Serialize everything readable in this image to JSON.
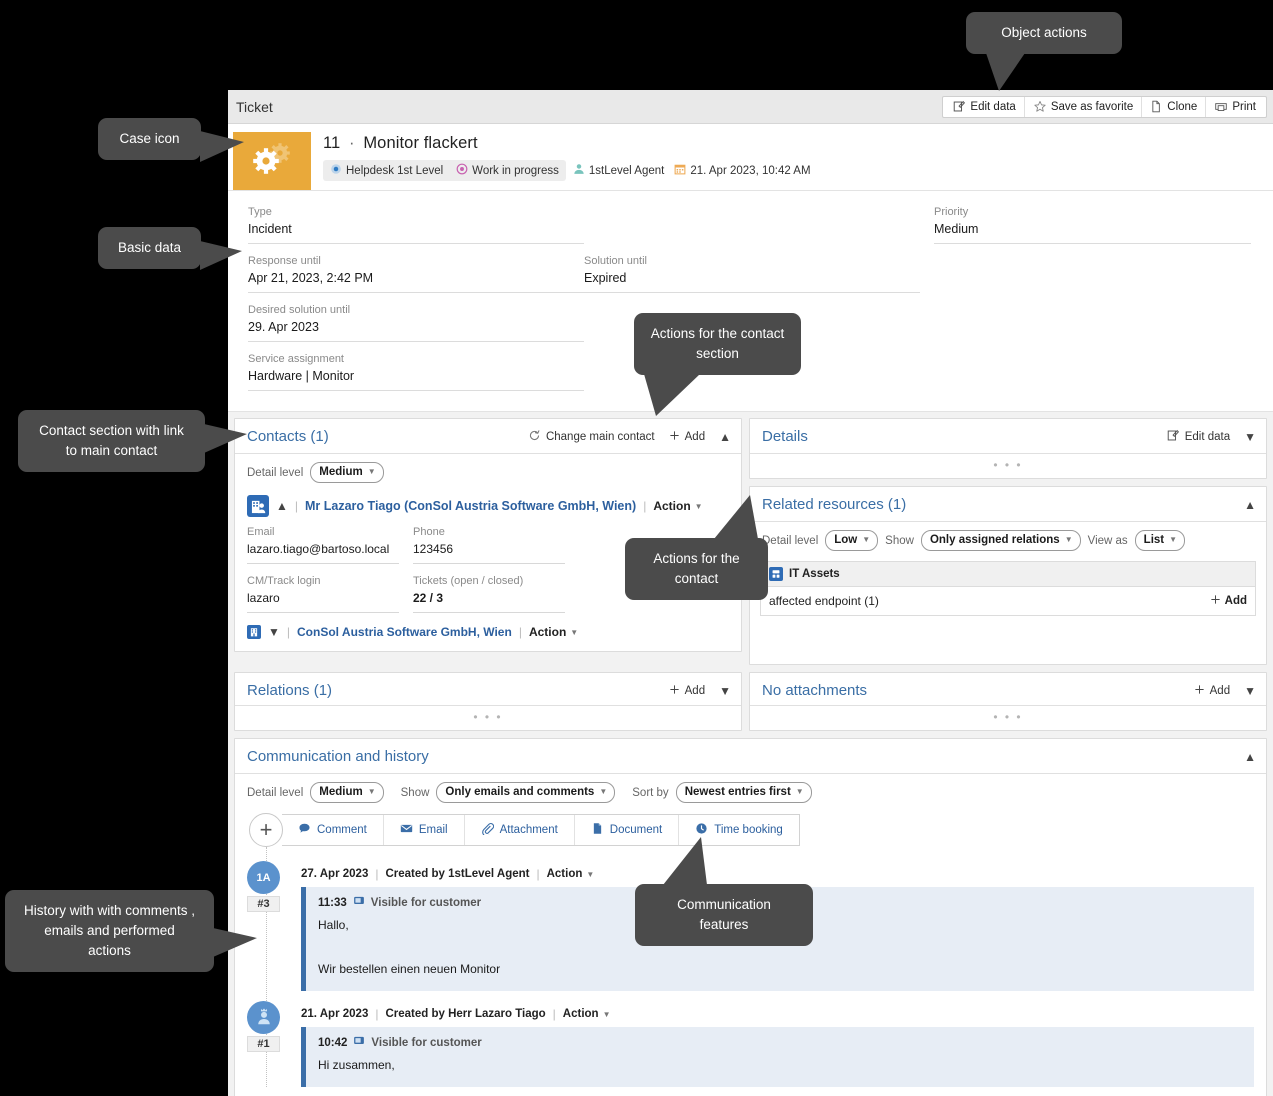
{
  "window": {
    "title": "Ticket"
  },
  "object_actions": [
    {
      "label": "Edit data",
      "icon": "edit-icon"
    },
    {
      "label": "Save as favorite",
      "icon": "star-icon"
    },
    {
      "label": "Clone",
      "icon": "copy-icon"
    },
    {
      "label": "Print",
      "icon": "printer-icon"
    }
  ],
  "case_header": {
    "icon": "gears-icon",
    "number": "11",
    "separator": "·",
    "title": "Monitor flackert",
    "queue": "Helpdesk 1st Level",
    "status": "Work in progress",
    "assignee": "1stLevel Agent",
    "date": "21. Apr 2023, 10:42 AM"
  },
  "basic_data": {
    "fields": [
      {
        "label": "Type",
        "value": "Incident"
      },
      {
        "label": "Priority",
        "value": "Medium"
      },
      {
        "label": "Response until",
        "value": "Apr 21, 2023, 2:42 PM"
      },
      {
        "label": "Solution until",
        "value": "Expired"
      },
      {
        "label": "Desired solution until",
        "value": "29. Apr 2023"
      },
      {
        "label": "Service assignment",
        "value": "Hardware | Monitor"
      }
    ]
  },
  "contacts": {
    "title": "Contacts (1)",
    "change_main_contact": "Change main contact",
    "add": "Add",
    "detail_level_label": "Detail level",
    "detail_level_value": "Medium",
    "contact": {
      "name": "Mr Lazaro Tiago (ConSol Austria Software GmbH, Wien)",
      "action": "Action",
      "fields": [
        {
          "label": "Email",
          "value": "lazaro.tiago@bartoso.local"
        },
        {
          "label": "Phone",
          "value": "123456"
        },
        {
          "label": "CM/Track login",
          "value": "lazaro"
        },
        {
          "label": "Tickets (open / closed)",
          "value": "22 / 3"
        }
      ]
    },
    "company": {
      "name": "ConSol Austria Software GmbH, Wien",
      "action": "Action"
    }
  },
  "details": {
    "title": "Details",
    "edit_data": "Edit data"
  },
  "related_resources": {
    "title": "Related resources (1)",
    "detail_level_label": "Detail level",
    "detail_level_value": "Low",
    "show_label": "Show",
    "show_value": "Only assigned relations",
    "view_as_label": "View as",
    "view_as_value": "List",
    "card_title": "IT Assets",
    "card_row": "affected endpoint (1)",
    "card_add": "Add"
  },
  "relations": {
    "title": "Relations (1)",
    "add": "Add"
  },
  "attachments": {
    "title": "No attachments",
    "add": "Add"
  },
  "communication": {
    "title": "Communication and history",
    "detail_level_label": "Detail level",
    "detail_level_value": "Medium",
    "show_label": "Show",
    "show_value": "Only emails and comments",
    "sort_by_label": "Sort by",
    "sort_by_value": "Newest entries first",
    "buttons": [
      {
        "label": "Comment",
        "icon": "comment-icon"
      },
      {
        "label": "Email",
        "icon": "envelope-icon"
      },
      {
        "label": "Attachment",
        "icon": "paperclip-icon"
      },
      {
        "label": "Document",
        "icon": "document-icon"
      },
      {
        "label": "Time booking",
        "icon": "clock-icon"
      }
    ],
    "entries": [
      {
        "avatar": "1A",
        "avatar_type": "initials",
        "number": "#3",
        "date": "27. Apr 2023",
        "created_by": "Created by 1stLevel Agent",
        "action": "Action",
        "time": "11:33",
        "visibility": "Visible for customer",
        "text_line1": "Hallo,",
        "text_line2": "Wir bestellen einen neuen Monitor"
      },
      {
        "avatar": "",
        "avatar_type": "person",
        "number": "#1",
        "date": "21. Apr 2023",
        "created_by": "Created by Herr Lazaro Tiago",
        "action": "Action",
        "time": "10:42",
        "visibility": "Visible for customer",
        "text_line1": "Hi zusammen,",
        "text_line2": ""
      }
    ]
  },
  "callouts": {
    "object_actions": "Object actions",
    "case_icon": "Case icon",
    "basic_data": "Basic data",
    "contact_section": "Contact section with link to main contact",
    "actions_contact_section": "Actions for the contact section",
    "actions_contact": "Actions for the contact",
    "communication_features": "Communication features",
    "history": "History with with comments , emails and performed actions"
  },
  "colors": {
    "case_icon_bg": "#e9a93a",
    "link_blue": "#2c5f9e",
    "heading_blue": "#3a6ea5",
    "avatar_blue": "#5b92cd",
    "entry_card_bg": "#e7edf5",
    "entry_card_bar": "#3b6ea8",
    "callout_bg": "#4b4b4b",
    "page_bg": "#000000"
  }
}
